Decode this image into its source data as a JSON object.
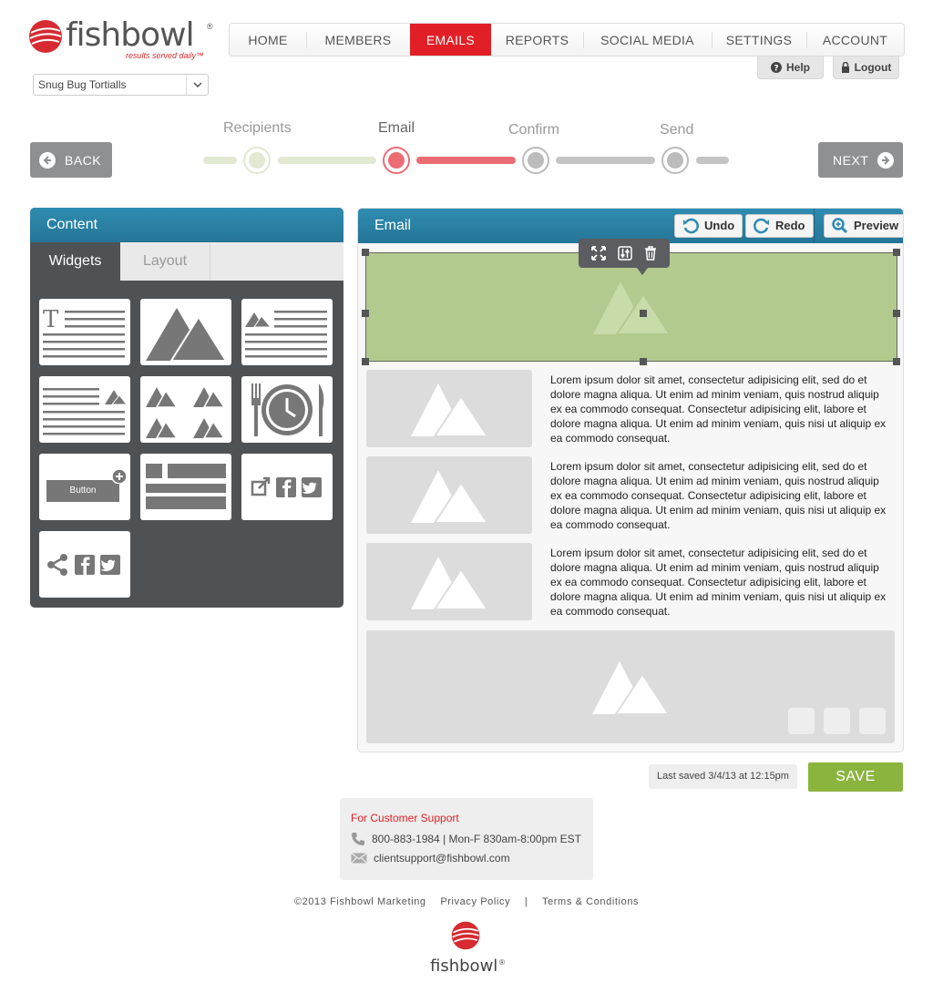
{
  "brand": {
    "wordmark": "fishbowl",
    "registered": "®",
    "tagline": "results served daily™"
  },
  "restaurant_select": {
    "value": "Snug Bug Tortialls"
  },
  "nav": {
    "items": [
      "HOME",
      "MEMBERS",
      "EMAILS",
      "REPORTS",
      "SOCIAL MEDIA",
      "SETTINGS",
      "ACCOUNT"
    ],
    "active": "EMAILS",
    "help_label": "Help",
    "logout_label": "Logout"
  },
  "steps": {
    "back_label": "BACK",
    "next_label": "NEXT",
    "items": [
      "Recipients",
      "Email",
      "Confirm",
      "Send"
    ],
    "current": "Email"
  },
  "content_panel": {
    "title": "Content",
    "tabs": [
      "Widgets",
      "Layout"
    ],
    "active_tab": "Widgets",
    "button_widget_label": "Button"
  },
  "email_panel": {
    "title": "Email",
    "undo_label": "Undo",
    "redo_label": "Redo",
    "preview_label": "Preview",
    "rows": [
      "Lorem ipsum dolor sit amet, consectetur adipisicing elit, sed do et dolore magna aliqua. Ut enim ad minim veniam, quis nostrud aliquip ex ea commodo consequat. Consectetur adipisicing elit, labore et dolore magna aliqua. Ut enim ad minim veniam, quis nisi ut aliquip ex ea commodo consequat.",
      "Lorem ipsum dolor sit amet, consectetur adipisicing elit, sed do et dolore magna aliqua. Ut enim ad minim veniam, quis nostrud aliquip ex ea commodo consequat. Consectetur adipisicing elit, labore et dolore magna aliqua. Ut enim ad minim veniam, quis nisi ut aliquip ex ea commodo consequat.",
      "Lorem ipsum dolor sit amet, consectetur adipisicing elit, sed do et dolore magna aliqua. Ut enim ad minim veniam, quis nostrud aliquip ex ea commodo consequat. Consectetur adipisicing elit, labore et dolore magna aliqua. Ut enim ad minim veniam, quis nisi ut aliquip ex ea commodo consequat."
    ]
  },
  "save": {
    "last_saved": "Last saved 3/4/13 at 12:15pm",
    "save_label": "SAVE"
  },
  "support": {
    "title": "For Customer Support",
    "phone": "800-883-1984 | Mon-F 830am-8:00pm EST",
    "email": "clientsupport@fishbowl.com"
  },
  "footer": {
    "copyright": "©2013 Fishbowl Marketing",
    "privacy": "Privacy Policy",
    "divider": "|",
    "terms": "Terms & Conditions",
    "wordmark": "fishbowl",
    "registered": "®"
  },
  "colors": {
    "accent_red": "#e21f26",
    "header_blue": "#2e8cb0",
    "panel_dark": "#4f5255",
    "save_green": "#8bb43f",
    "hero_green": "#b3ca8f"
  }
}
